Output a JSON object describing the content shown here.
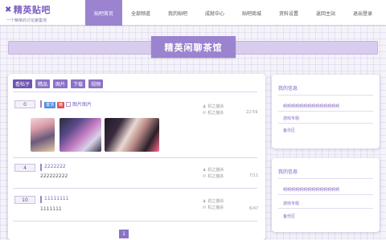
{
  "logo": {
    "title": "精英贴吧",
    "subtitle": "一个精英的讨论聚集地"
  },
  "nav": [
    {
      "label": "贴吧首页",
      "active": true
    },
    {
      "label": "全部频道",
      "active": false
    },
    {
      "label": "我的贴吧",
      "active": false
    },
    {
      "label": "成就中心",
      "active": false
    },
    {
      "label": "贴吧商城",
      "active": false
    },
    {
      "label": "资料设置",
      "active": false
    },
    {
      "label": "返回主站",
      "active": false
    },
    {
      "label": "退出登录",
      "active": false
    }
  ],
  "banner": {
    "title": "精英闲聊茶馆"
  },
  "tabs": [
    "看帖子",
    "精品",
    "图片",
    "下载",
    "视频"
  ],
  "posts": [
    {
      "count": "0",
      "badges": [
        "置顶",
        "精"
      ],
      "title": "图片图片",
      "body": "",
      "author": "机之猫杀",
      "last_reply": "机之猫杀",
      "time": "22:59"
    },
    {
      "count": "4",
      "title": "2222222",
      "body": "222222222",
      "author": "机之猫杀",
      "last_reply": "机之猫杀",
      "time": "7/11"
    },
    {
      "count": "10",
      "title": "11111111",
      "body": "1111111",
      "author": "机之猫杀",
      "last_reply": "机之猫杀",
      "time": "6/47"
    }
  ],
  "pager": {
    "current": "1"
  },
  "side_cards": [
    {
      "title": "我的信息",
      "items": [
        "啊啊啊啊啊啊啊啊啊啊啊啊啊啊",
        "游戏专题",
        "备份区"
      ]
    },
    {
      "title": "我的信息",
      "items": [
        "啊啊啊啊啊啊啊啊啊啊啊啊啊啊",
        "游戏专题",
        "备份区"
      ]
    }
  ],
  "colors": {
    "accent": "#9b83cf",
    "tab": "#8b72c6",
    "link": "#7a63c0"
  }
}
